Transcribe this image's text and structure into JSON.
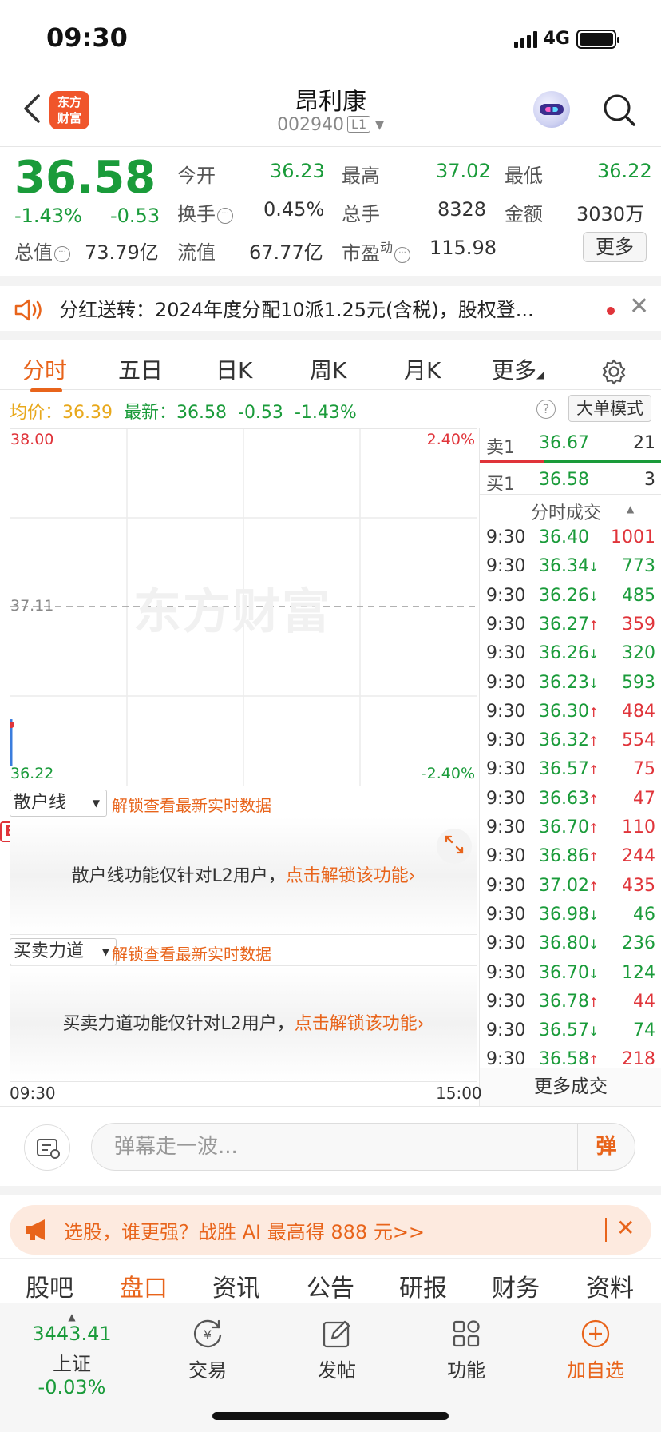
{
  "status_bar": {
    "time": "09:30",
    "network": "4G"
  },
  "header": {
    "logo_line1": "东方",
    "logo_line2": "财富",
    "name": "昂利康",
    "code": "002940",
    "level_tag": "L1"
  },
  "quote": {
    "price": "36.58",
    "change_pct": "-1.43%",
    "change": "-0.53",
    "open_label": "今开",
    "open": "36.23",
    "high_label": "最高",
    "high": "37.02",
    "low_label": "最低",
    "low": "36.22",
    "turnover_label": "换手",
    "turnover": "0.45%",
    "volume_label": "总手",
    "volume": "8328",
    "amount_label": "金额",
    "amount": "3030万",
    "mktcap_label": "总值",
    "mktcap": "73.79亿",
    "float_label": "流值",
    "float_cap": "67.77亿",
    "pe_label": "市盈",
    "pe_sup": "动",
    "pe": "115.98",
    "more_label": "更多"
  },
  "notice": {
    "text": "分红送转：2024年度分配10派1.25元(含税)，股权登..."
  },
  "tabs": [
    "分时",
    "五日",
    "日K",
    "周K",
    "月K",
    "更多"
  ],
  "info_line": {
    "avg_label": "均价：",
    "avg": "36.39",
    "latest_label": "最新：",
    "latest": "36.58",
    "change": "-0.53",
    "change_pct": "-1.43%",
    "help": "?",
    "mode_button": "大单模式"
  },
  "chart": {
    "top_price": "38.00",
    "mid_price": "37.11",
    "bottom_price": "36.22",
    "top_pct": "2.40%",
    "bottom_pct": "-2.40%",
    "watermark": "东方财富",
    "start_time": "09:30",
    "end_time": "15:00"
  },
  "chart_data": {
    "type": "line",
    "x": [
      "09:30"
    ],
    "series": [
      {
        "values": [
          36.58
        ]
      }
    ],
    "ylim": [
      36.22,
      38.0
    ],
    "grid": true
  },
  "order_book": {
    "ask_label": "卖1",
    "ask_price": "36.67",
    "ask_vol": "21",
    "bid_label": "买1",
    "bid_price": "36.58",
    "bid_vol": "3",
    "ticks_header": "分时成交",
    "more_label": "更多成交"
  },
  "ticks": [
    {
      "time": "9:30",
      "price": "36.40",
      "arrow": "",
      "vol": "1001",
      "pc": "green",
      "vc": "red"
    },
    {
      "time": "9:30",
      "price": "36.34",
      "arrow": "↓",
      "vol": "773",
      "pc": "green",
      "vc": "green"
    },
    {
      "time": "9:30",
      "price": "36.26",
      "arrow": "↓",
      "vol": "485",
      "pc": "green",
      "vc": "green"
    },
    {
      "time": "9:30",
      "price": "36.27",
      "arrow": "↑",
      "vol": "359",
      "pc": "green",
      "vc": "red"
    },
    {
      "time": "9:30",
      "price": "36.26",
      "arrow": "↓",
      "vol": "320",
      "pc": "green",
      "vc": "green"
    },
    {
      "time": "9:30",
      "price": "36.23",
      "arrow": "↓",
      "vol": "593",
      "pc": "green",
      "vc": "green"
    },
    {
      "time": "9:30",
      "price": "36.30",
      "arrow": "↑",
      "vol": "484",
      "pc": "green",
      "vc": "red"
    },
    {
      "time": "9:30",
      "price": "36.32",
      "arrow": "↑",
      "vol": "554",
      "pc": "green",
      "vc": "red"
    },
    {
      "time": "9:30",
      "price": "36.57",
      "arrow": "↑",
      "vol": "75",
      "pc": "green",
      "vc": "red"
    },
    {
      "time": "9:30",
      "price": "36.63",
      "arrow": "↑",
      "vol": "47",
      "pc": "green",
      "vc": "red"
    },
    {
      "time": "9:30",
      "price": "36.70",
      "arrow": "↑",
      "vol": "110",
      "pc": "green",
      "vc": "red"
    },
    {
      "time": "9:30",
      "price": "36.86",
      "arrow": "↑",
      "vol": "244",
      "pc": "green",
      "vc": "red"
    },
    {
      "time": "9:30",
      "price": "37.02",
      "arrow": "↑",
      "vol": "435",
      "pc": "green",
      "vc": "red"
    },
    {
      "time": "9:30",
      "price": "36.98",
      "arrow": "↓",
      "vol": "46",
      "pc": "green",
      "vc": "green"
    },
    {
      "time": "9:30",
      "price": "36.80",
      "arrow": "↓",
      "vol": "236",
      "pc": "green",
      "vc": "green"
    },
    {
      "time": "9:30",
      "price": "36.70",
      "arrow": "↓",
      "vol": "124",
      "pc": "green",
      "vc": "green"
    },
    {
      "time": "9:30",
      "price": "36.78",
      "arrow": "↑",
      "vol": "44",
      "pc": "green",
      "vc": "red"
    },
    {
      "time": "9:30",
      "price": "36.57",
      "arrow": "↓",
      "vol": "74",
      "pc": "green",
      "vc": "green"
    },
    {
      "time": "9:30",
      "price": "36.58",
      "arrow": "↑",
      "vol": "218",
      "pc": "green",
      "vc": "red"
    }
  ],
  "retail_panel": {
    "dropdown": "散户线",
    "unlock_hint": "解锁查看最新实时数据",
    "b_marker": "B",
    "body_text": "散户线功能仅针对L2用户，",
    "body_link": "点击解锁该功能›"
  },
  "force_panel": {
    "dropdown": "买卖力道",
    "unlock_hint": "解锁查看最新实时数据",
    "body_text": "买卖力道功能仅针对L2用户，",
    "body_link": "点击解锁该功能›"
  },
  "comment_bar": {
    "placeholder": "弹幕走一波...",
    "button": "弹"
  },
  "promo": {
    "text": "选股，谁更强？战胜 AI 最高得 888 元>>"
  },
  "bottom_tabs": [
    "股吧",
    "盘口",
    "资讯",
    "公告",
    "研报",
    "财务",
    "资料"
  ],
  "bottom_nav": {
    "index_value": "3443.41",
    "index_name": "上证",
    "index_change": "-0.03%",
    "trade": "交易",
    "post": "发帖",
    "func": "功能",
    "add": "加自选"
  },
  "colors": {
    "up": "#e0343a",
    "down": "#1a9b3a",
    "accent": "#e8641b"
  }
}
